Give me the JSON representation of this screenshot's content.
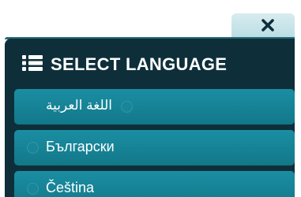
{
  "close_button": {
    "icon": "close-icon"
  },
  "header": {
    "icon": "list-icon",
    "title": "SELECT LANGUAGE"
  },
  "languages": [
    {
      "label": "اللغة العربية",
      "direction": "rtl",
      "selected": false
    },
    {
      "label": "Български",
      "direction": "ltr",
      "selected": false
    },
    {
      "label": "Čeština",
      "direction": "ltr",
      "selected": false
    }
  ],
  "colors": {
    "panel": "#0e2f3a",
    "item": "#1882967",
    "tab": "#c7e4e9",
    "text": "#ffffff"
  }
}
